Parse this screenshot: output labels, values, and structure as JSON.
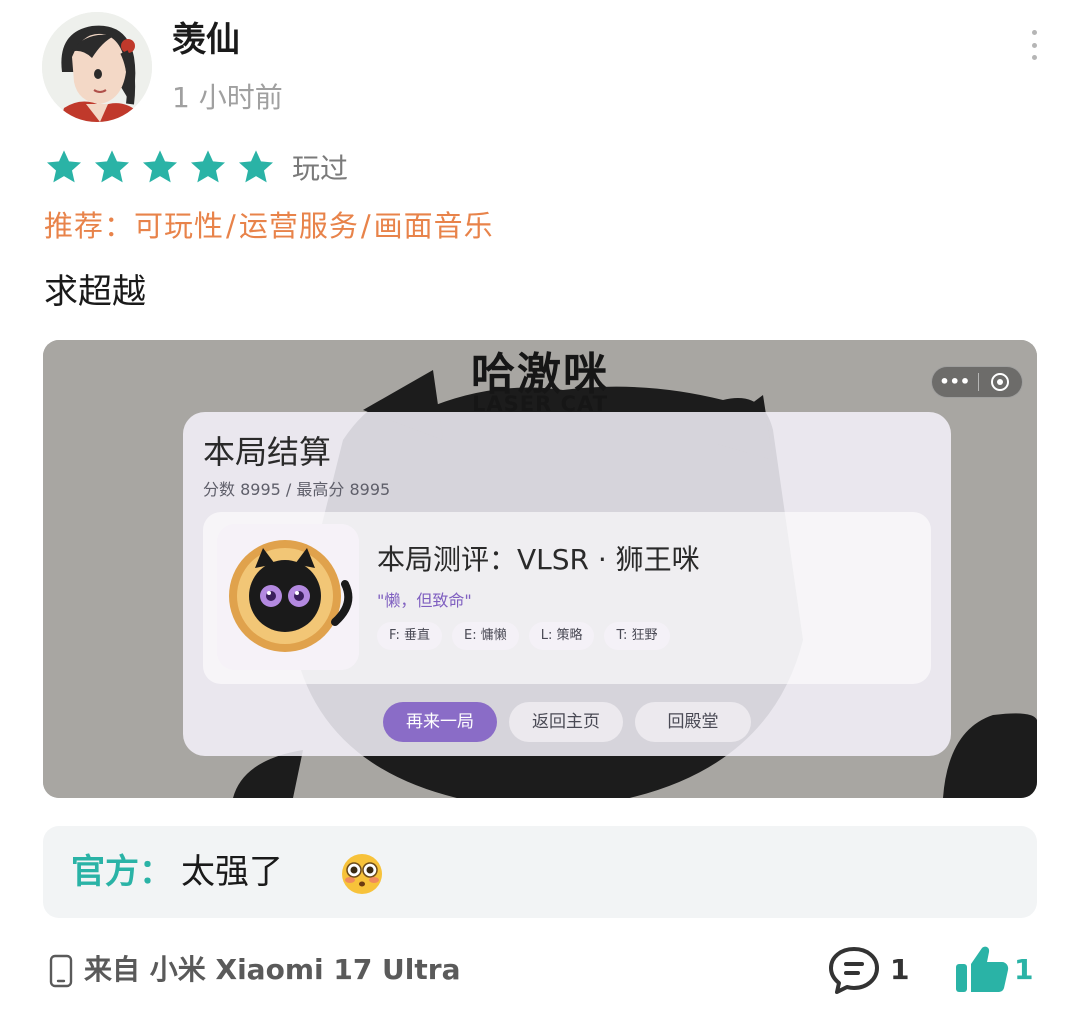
{
  "post": {
    "username": "羡仙",
    "time": "1 小时前",
    "rating": 5,
    "rating_label": "玩过",
    "recommend_prefix": "推荐：",
    "recommend_items": [
      "可玩性",
      "运营服务",
      "画面音乐"
    ],
    "recommend_separator": "/",
    "content": "求超越"
  },
  "game_screenshot": {
    "title": "哈激咪",
    "subtitle": "LASER CAT",
    "capsule_more": "•••",
    "panel": {
      "title": "本局结算",
      "score_line": "分数 8995 / 最高分 8995",
      "eval_title": "本局测评：VLSR · 狮王咪",
      "eval_quote": "\"懒，但致命\"",
      "tags": [
        "F: 垂直",
        "E: 慵懒",
        "L: 策略",
        "T: 狂野"
      ],
      "buttons": {
        "again": "再来一局",
        "home": "返回主页",
        "hall": "回殿堂"
      }
    }
  },
  "official_reply": {
    "label": "官方：",
    "text": "太强了"
  },
  "footer": {
    "device": "来自 小米 Xiaomi 17 Ultra",
    "comment_count": "1",
    "like_count": "1"
  },
  "colors": {
    "star": "#2ab3a6",
    "recommend": "#e8834a",
    "official_label": "#2ab3a6",
    "primary_button": "#8a6cc7",
    "like": "#2ab3a6"
  }
}
